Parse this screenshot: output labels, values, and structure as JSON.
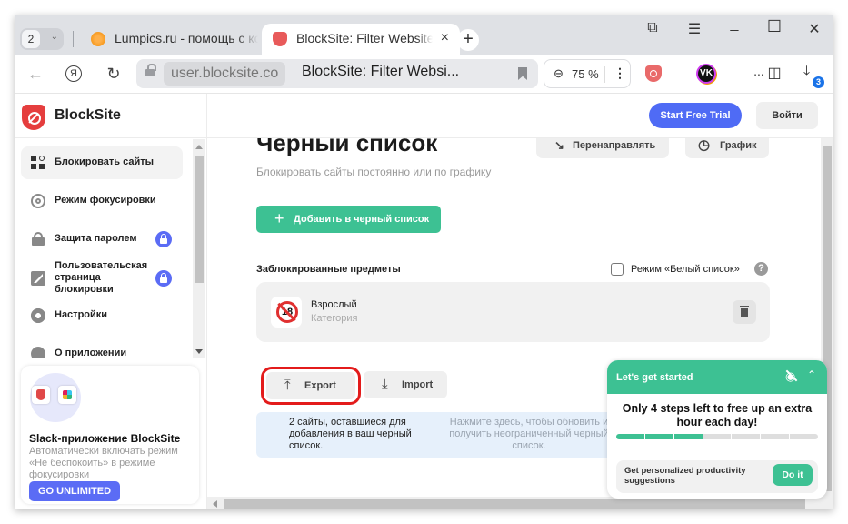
{
  "browser": {
    "tab_count": "2",
    "tabs": [
      {
        "title": "Lumpics.ru - помощь с компьютером",
        "active": false
      },
      {
        "title": "BlockSite: Filter Website",
        "active": true
      }
    ],
    "new_tab_label": "+",
    "window_controls": {
      "collections": "⧉",
      "menu": "☰",
      "minimize": "_",
      "maximize": "☐",
      "close": "✕"
    },
    "url_domain": "user.blocksite.co",
    "page_title": "BlockSite: Filter Websi...",
    "zoom": "75 %",
    "extensions_more": "...",
    "downloads_badge": "3"
  },
  "sidebar": {
    "brand": "BlockSite",
    "items": [
      {
        "label": "Блокировать сайты",
        "icon": "grid-block-icon",
        "active": true,
        "locked": false
      },
      {
        "label": "Режим фокусировки",
        "icon": "target-icon",
        "active": false,
        "locked": false
      },
      {
        "label": "Защита паролем",
        "icon": "lock-icon",
        "active": false,
        "locked": true
      },
      {
        "label": "Пользовательская страница блокировки",
        "icon": "custom-page-icon",
        "active": false,
        "locked": true
      },
      {
        "label": "Настройки",
        "icon": "gear-icon",
        "active": false,
        "locked": false
      },
      {
        "label": "О приложении",
        "icon": "info-icon",
        "active": false,
        "locked": false
      }
    ],
    "promo": {
      "title": "Slack-приложение BlockSite",
      "description": "Автоматически включать режим «Не беспокоить» в режиме фокусировки",
      "button": "GO UNLIMITED"
    }
  },
  "header": {
    "trial_button": "Start Free Trial",
    "login_button": "Войти"
  },
  "main": {
    "title": "Черный список",
    "subtitle": "Блокировать сайты постоянно или по графику",
    "redirect_button": "Перенаправлять",
    "schedule_button": "График",
    "add_button": "Добавить в черный список",
    "blocked_label": "Заблокированные предметы",
    "whitelist_label": "Режим «Белый список»",
    "whitelist_checked": false,
    "help": "?",
    "blocked_items": [
      {
        "name": "Взрослый",
        "type": "Категория"
      }
    ],
    "export_button": "Export",
    "import_button": "Import",
    "info_left": "2 сайты, оставшиеся для добавления в ваш черный список.",
    "info_right": "Нажмите здесь, чтобы обновить и получить неограниченный черный список."
  },
  "onboarding": {
    "header": "Let's get started",
    "message": "Only 4 steps left to free up an extra hour each day!",
    "steps_total": 7,
    "steps_done": 3,
    "task": "Get personalized productivity suggestions",
    "task_button": "Do it"
  },
  "colors": {
    "brand_red": "#e53e3e",
    "accent_blue": "#4f6bf5",
    "accent_green": "#3dc193",
    "highlight_red": "#e31b1b"
  }
}
